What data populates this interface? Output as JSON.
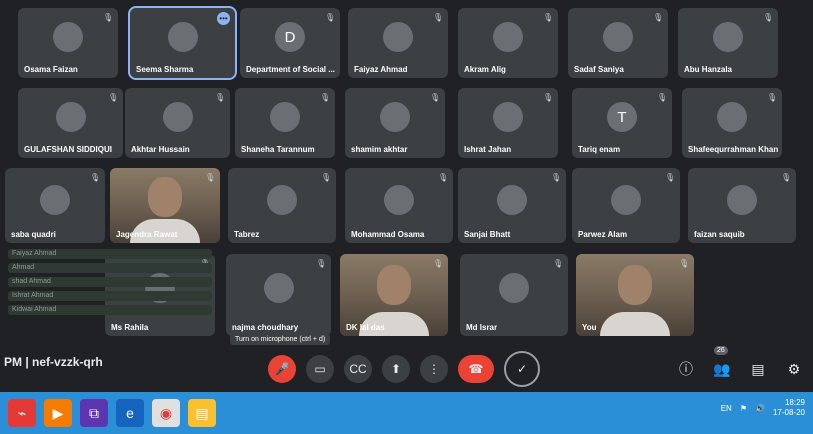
{
  "tiles": [
    {
      "name": "Osama Faizan",
      "initial": ""
    },
    {
      "name": "Seema Sharma",
      "initial": "",
      "active": true,
      "more": "•••"
    },
    {
      "name": "Department of Social ...",
      "initial": "D"
    },
    {
      "name": "Faiyaz Ahmad",
      "initial": ""
    },
    {
      "name": "Akram Alig",
      "initial": ""
    },
    {
      "name": "Sadaf Saniya",
      "initial": ""
    },
    {
      "name": "Abu Hanzala",
      "initial": ""
    },
    {
      "name": "GULAFSHAN SIDDIQUI",
      "initial": ""
    },
    {
      "name": "Akhtar Hussain",
      "initial": ""
    },
    {
      "name": "Shaneha Tarannum",
      "initial": ""
    },
    {
      "name": "shamim akhtar",
      "initial": ""
    },
    {
      "name": "Ishrat Jahan",
      "initial": ""
    },
    {
      "name": "Tariq enam",
      "initial": "T"
    },
    {
      "name": "Shafeequrrahman Khan",
      "initial": ""
    },
    {
      "name": "saba quadri",
      "initial": ""
    },
    {
      "name": "Jagendra Rawat",
      "initial": "",
      "video": true
    },
    {
      "name": "Tabrez",
      "initial": ""
    },
    {
      "name": "Mohammad Osama",
      "initial": ""
    },
    {
      "name": "Sanjai Bhatt",
      "initial": ""
    },
    {
      "name": "Parwez Alam",
      "initial": ""
    },
    {
      "name": "faizan saquib",
      "initial": ""
    },
    {
      "name": "Ms Rahila",
      "initial": ""
    },
    {
      "name": "najma choudhary",
      "initial": ""
    },
    {
      "name": "DK lal das",
      "initial": "",
      "video": true
    },
    {
      "name": "Md Israr",
      "initial": ""
    },
    {
      "name": "You",
      "initial": "",
      "video": true
    }
  ],
  "sidebar_rows": [
    "Faiyaz Ahmad",
    "Ahmad",
    "shad Ahmad",
    "Ishrat Ahmad",
    "Kidwai Ahmad"
  ],
  "meeting": {
    "code": "PM  |  nef-vzzk-qrh",
    "tooltip": "Turn on microphone (ctrl + d)"
  },
  "controls": {
    "mic": "🎤",
    "camera": "▭",
    "captions": "CC",
    "present": "⬆",
    "more": "⋮",
    "end": "☎",
    "check": "✓"
  },
  "right_icons": {
    "info": "ⓘ",
    "people": "👥",
    "people_count": "26",
    "chat": "▤",
    "activities": "⚙"
  },
  "taskbar": {
    "lang": "EN",
    "time": "18:29",
    "date": "17-08-20"
  }
}
